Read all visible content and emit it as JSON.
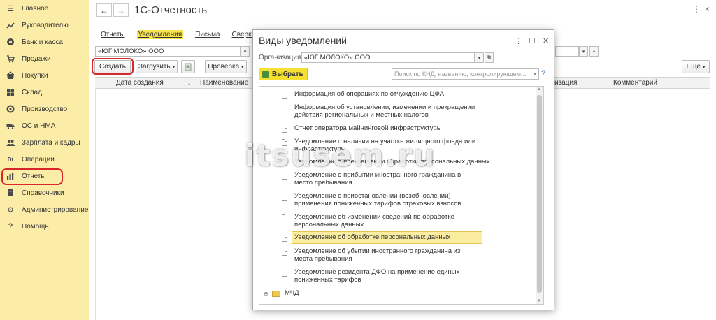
{
  "sidebar": {
    "items": [
      {
        "label": "Главное",
        "icon": "menu-icon"
      },
      {
        "label": "Руководителю",
        "icon": "trend-icon"
      },
      {
        "label": "Банк и касса",
        "icon": "coins-icon"
      },
      {
        "label": "Продажи",
        "icon": "cart-icon"
      },
      {
        "label": "Покупки",
        "icon": "basket-icon"
      },
      {
        "label": "Склад",
        "icon": "warehouse-icon"
      },
      {
        "label": "Производство",
        "icon": "factory-icon"
      },
      {
        "label": "ОС и НМА",
        "icon": "truck-icon"
      },
      {
        "label": "Зарплата и кадры",
        "icon": "people-icon"
      },
      {
        "label": "Операции",
        "icon": "operations-icon"
      },
      {
        "label": "Отчеты",
        "icon": "chart-icon"
      },
      {
        "label": "Справочники",
        "icon": "book-icon"
      },
      {
        "label": "Администрирование",
        "icon": "gear-icon"
      },
      {
        "label": "Помощь",
        "icon": "question-icon"
      }
    ]
  },
  "header": {
    "back": "←",
    "forward": "→",
    "title": "1С-Отчетность",
    "more": "⋮",
    "close": "×"
  },
  "tabs": [
    "Отчеты",
    "Уведомления",
    "Письма",
    "Сверки"
  ],
  "main": {
    "organization": "«ЮГ МОЛОКО» ООО",
    "toolbar": {
      "create": "Создать",
      "load": "Загрузить",
      "check": "Проверка",
      "more": "Еще"
    },
    "columns": {
      "date": "Дата создания",
      "sort": "↓",
      "name": "Наименование",
      "org": "изация",
      "comment": "Комментарий"
    }
  },
  "dialog": {
    "title": "Виды уведомлений",
    "more": "⋮",
    "maximize": "☐",
    "close": "✕",
    "org_label": "Организация:",
    "org_value": "«ЮГ МОЛОКО» ООО",
    "select": "Выбрать",
    "search_placeholder": "Поиск по КНД, названию, контролирующем...",
    "help": "?",
    "items": [
      "Информация об операциях по отчуждению ЦФА",
      "Информация об установлении, изменении и прекращении действия региональных и местных налогов",
      "Отчет оператора майнинговой инфраструктуры",
      "Уведомление о наличии на участке жилищного фонда или инфраструктуры",
      "Уведомление о прекращении обработки персональных данных",
      "Уведомление о прибытии иностранного гражданина в место пребывания",
      "Уведомление о приостановлении (возобновлении) применения пониженных тарифов страховых взносов",
      "Уведомление об изменении сведений по обработке персональных данных",
      "Уведомление об обработке персональных данных",
      "Уведомление об убытии иностранного гражданина из места пребывания",
      "Уведомление резидента ДФО на применение единых пониженных тарифов"
    ],
    "folder": "МЧД"
  },
  "watermark": "itsusem.ru"
}
